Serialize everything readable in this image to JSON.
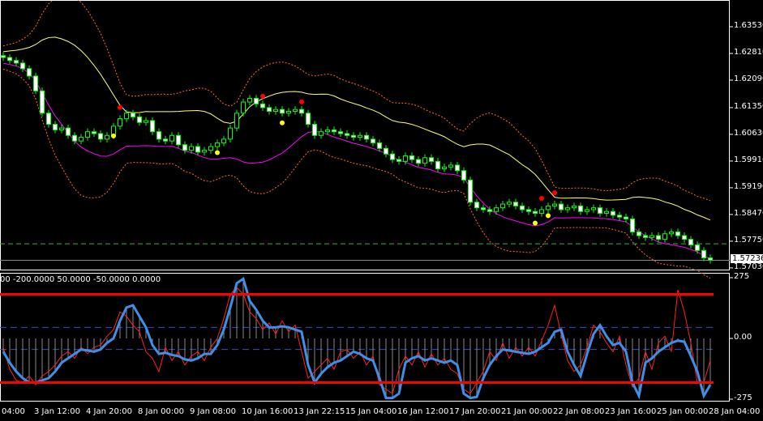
{
  "chart_data": {
    "type": "candlestick",
    "price_axis": {
      "ticks": [
        "1.63530",
        "1.62810",
        "1.62090",
        "1.61350",
        "1.60630",
        "1.59910",
        "1.59190",
        "1.58470",
        "1.57750",
        "1.57030"
      ],
      "range": [
        1.5703,
        1.6353
      ],
      "current_price": "1.57236",
      "dashed_level": 1.5768
    },
    "time_axis": {
      "ticks": [
        "04:00",
        "3 Jan 12:00",
        "4 Jan 20:00",
        "8 Jan 00:00",
        "9 Jan 08:00",
        "10 Jan 16:00",
        "13 Jan 22:15",
        "15 Jan 04:00",
        "16 Jan 12:00",
        "17 Jan 20:00",
        "21 Jan 00:00",
        "22 Jan 08:00",
        "23 Jan 16:00",
        "25 Jan 00:00",
        "28 Jan 04:00"
      ]
    },
    "closes": [
      1.627,
      1.6262,
      1.6255,
      1.624,
      1.622,
      1.618,
      1.612,
      1.609,
      1.6075,
      1.608,
      1.606,
      1.6045,
      1.6055,
      1.607,
      1.6065,
      1.605,
      1.606,
      1.6085,
      1.6105,
      1.612,
      1.611,
      1.6095,
      1.61,
      1.607,
      1.605,
      1.6045,
      1.606,
      1.6035,
      1.602,
      1.603,
      1.6015,
      1.602,
      1.603,
      1.604,
      1.605,
      1.608,
      1.612,
      1.615,
      1.616,
      1.6145,
      1.6135,
      1.6125,
      1.613,
      1.612,
      1.6125,
      1.613,
      1.612,
      1.609,
      1.606,
      1.607,
      1.6075,
      1.607,
      1.6065,
      1.606,
      1.6055,
      1.606,
      1.605,
      1.604,
      1.6025,
      1.601,
      1.5995,
      1.599,
      1.6005,
      1.5995,
      1.5985,
      1.6,
      1.599,
      1.597,
      1.5975,
      1.598,
      1.5965,
      1.594,
      1.588,
      1.5865,
      1.586,
      1.5855,
      1.5865,
      1.5875,
      1.588,
      1.587,
      1.586,
      1.5855,
      1.585,
      1.586,
      1.587,
      1.5875,
      1.586,
      1.5865,
      1.587,
      1.5855,
      1.586,
      1.5865,
      1.585,
      1.5855,
      1.5845,
      1.584,
      1.5835,
      1.58,
      1.579,
      1.5785,
      1.579,
      1.578,
      1.5795,
      1.58,
      1.579,
      1.578,
      1.5765,
      1.575,
      1.573,
      1.5724
    ],
    "signals_up": [
      17,
      33,
      43,
      82,
      84
    ],
    "signals_down": [
      18,
      40,
      46,
      83,
      85
    ],
    "indicator": {
      "label": "00 -200.0000 50.0000 -50.0000 0.0000",
      "axis_ticks": [
        "275",
        "0.00",
        "-275"
      ],
      "range": [
        -275,
        275
      ],
      "levels": {
        "red": [
          200,
          -200
        ],
        "blue_dashed": [
          50,
          -50
        ]
      },
      "cci": [
        -60,
        -110,
        -150,
        -180,
        -200,
        -200,
        -190,
        -180,
        -150,
        -110,
        -90,
        -70,
        -50,
        -55,
        -60,
        -50,
        -20,
        0,
        80,
        140,
        150,
        100,
        50,
        -30,
        -70,
        -65,
        -75,
        -80,
        -95,
        -100,
        -90,
        -70,
        -70,
        -30,
        40,
        140,
        250,
        270,
        170,
        130,
        80,
        50,
        50,
        55,
        50,
        40,
        30,
        -120,
        -200,
        -160,
        -130,
        -110,
        -100,
        -80,
        -60,
        -70,
        -90,
        -100,
        -180,
        -270,
        -270,
        -250,
        -110,
        -90,
        -80,
        -100,
        -90,
        -100,
        -110,
        -100,
        -120,
        -250,
        -270,
        -265,
        -180,
        -120,
        -80,
        -50,
        -55,
        -60,
        -65,
        -70,
        -60,
        -40,
        -20,
        30,
        40,
        -60,
        -120,
        -170,
        -70,
        20,
        60,
        10,
        -30,
        -20,
        -60,
        -200,
        -260,
        -110,
        -90,
        -60,
        -40,
        -20,
        -10,
        -15,
        -80,
        -150,
        -260,
        -210
      ],
      "fast": [
        -40,
        -140,
        -190,
        -200,
        -170,
        -210,
        -170,
        -150,
        -120,
        -80,
        -60,
        -90,
        -40,
        -70,
        -40,
        -30,
        10,
        40,
        120,
        100,
        60,
        30,
        -60,
        -90,
        -150,
        -40,
        -100,
        -60,
        -120,
        -80,
        -60,
        -100,
        -40,
        0,
        90,
        200,
        230,
        200,
        120,
        90,
        40,
        70,
        20,
        80,
        30,
        60,
        -60,
        -180,
        -150,
        -120,
        -90,
        -140,
        -60,
        -50,
        -90,
        -60,
        -120,
        -80,
        -210,
        -230,
        -250,
        -140,
        -80,
        -120,
        -60,
        -130,
        -70,
        -120,
        -90,
        -140,
        -160,
        -230,
        -250,
        -200,
        -150,
        -60,
        -100,
        -20,
        -90,
        -40,
        -80,
        -40,
        -80,
        -10,
        60,
        150,
        20,
        -100,
        -150,
        -120,
        -40,
        60,
        30,
        -20,
        -60,
        10,
        -120,
        -220,
        -180,
        -60,
        -140,
        -20,
        10,
        -60,
        220,
        120,
        -20,
        -200,
        -200,
        -100
      ]
    }
  },
  "colors": {
    "bg": "#000000",
    "grid": "#ffffff",
    "bull": "#00ff00",
    "bear": "#ffffff",
    "upper": "#ffff80",
    "lower": "#ff00ff",
    "outer": "#ff6a2a",
    "cci": "#3f8fe8",
    "fast": "#ff2020",
    "level": "#ff0000",
    "dashed": "#3050c0"
  }
}
